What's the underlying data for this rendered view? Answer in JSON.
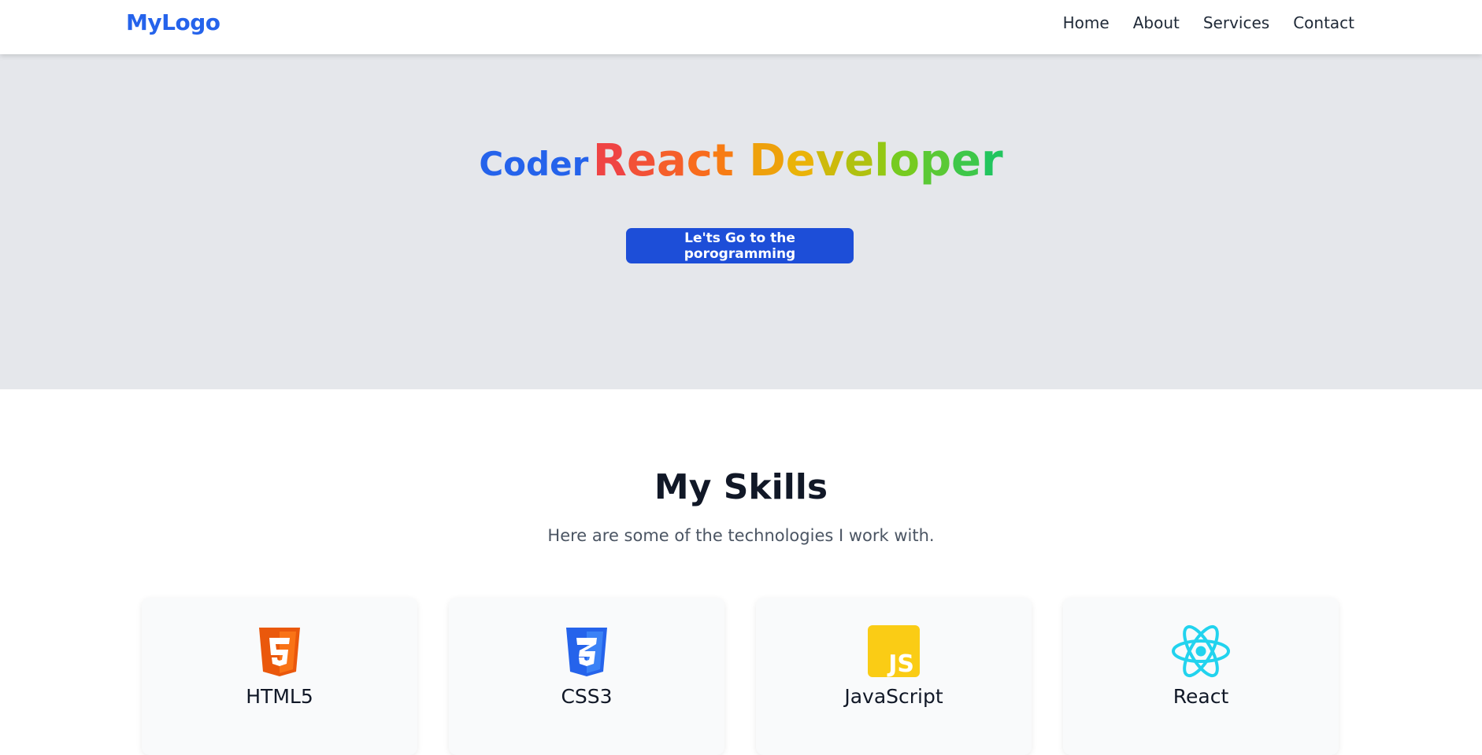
{
  "navbar": {
    "logo": "MyLogo",
    "links": [
      "Home",
      "About",
      "Services",
      "Contact"
    ]
  },
  "hero": {
    "prefix": "Coder",
    "role": "React Developer",
    "button_label": "Le'ts Go to the porogramming"
  },
  "skills": {
    "title": "My Skills",
    "subtitle": "Here are some of the technologies I work with.",
    "items": [
      {
        "name": "HTML5",
        "icon": "html5-icon"
      },
      {
        "name": "CSS3",
        "icon": "css3-icon"
      },
      {
        "name": "JavaScript",
        "icon": "javascript-icon"
      },
      {
        "name": "React",
        "icon": "react-icon"
      }
    ]
  },
  "colors": {
    "brand": "#2563eb",
    "button": "#1d4ed8",
    "hero_bg": "#e5e7eb",
    "gradient": [
      "#ef4444",
      "#f97316",
      "#eab308",
      "#84cc16",
      "#22c55e"
    ]
  }
}
